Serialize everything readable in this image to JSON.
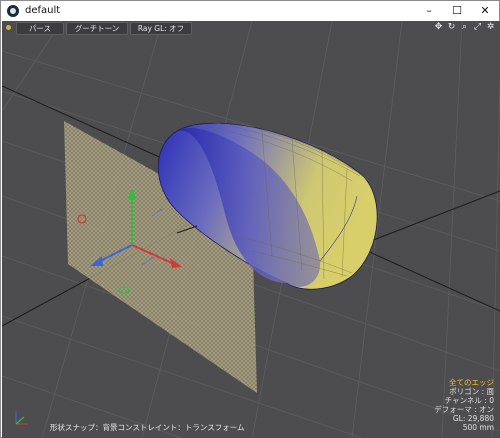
{
  "window": {
    "title": "default",
    "controls": [
      "–",
      "☐",
      "✕"
    ]
  },
  "viewport": {
    "toolbar": {
      "perspective_label": "パース",
      "shading_label": "グーチトーン",
      "raygl_label": "Ray GL: オフ"
    },
    "nav_icons": [
      "move-view-icon",
      "rotate-view-icon",
      "zoom-view-icon",
      "fit-view-icon",
      "settings-icon"
    ],
    "info": {
      "selection": "全てのエッジ",
      "polygons": "ポリゴン : 面",
      "channels": "チャンネル : 0",
      "deformers": "デフォーマ : オン",
      "gl": "GL: 29,880",
      "scale": "500 mm"
    },
    "status": "形状スナップ：背景コンストレイント：トランスフォーム"
  },
  "colors": {
    "viewport_bg": "#4d4d4f",
    "mesh_yellow": "#d8cf6a",
    "mesh_blue": "#2a2fb8",
    "axis_x": "#d23a3a",
    "axis_y": "#2fbf3f",
    "axis_z": "#3a66d8",
    "highlight": "#f0c030"
  }
}
